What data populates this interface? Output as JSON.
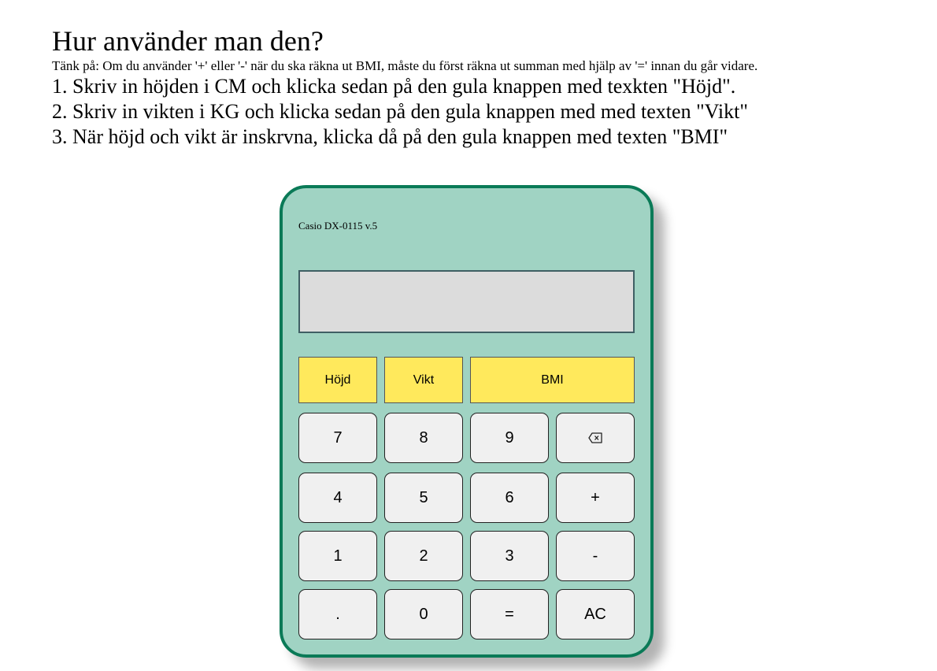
{
  "instructions": {
    "heading": "Hur använder man den?",
    "note": "Tänk på: Om du använder '+' eller '-' när du ska räkna ut BMI, måste du först räkna ut summan med hjälp av '=' innan du går vidare.",
    "steps": [
      "1. Skriv in höjden i CM och klicka sedan på den gula knappen med texkten \"Höjd\".",
      "2. Skriv in vikten i KG och klicka sedan på den gula knappen med med texten \"Vikt\"",
      "3. När höjd och vikt är inskrvna, klicka då på den gula knappen med texten \"BMI\""
    ]
  },
  "calculator": {
    "model": "Casio DX-0115 v.5",
    "display_value": "",
    "function_buttons": {
      "height": "Höjd",
      "weight": "Vikt",
      "bmi": "BMI"
    },
    "keys": {
      "k7": "7",
      "k8": "8",
      "k9": "9",
      "k4": "4",
      "k5": "5",
      "k6": "6",
      "plus": "+",
      "k1": "1",
      "k2": "2",
      "k3": "3",
      "minus": "-",
      "dot": ".",
      "k0": "0",
      "equals": "=",
      "clear": "AC"
    },
    "backspace_icon": "backspace-icon",
    "colors": {
      "body": "#a0d3c3",
      "border": "#0a7a57",
      "display": "#dcdcdc",
      "function_button": "#ffe95c",
      "key": "#f0f0f0"
    }
  }
}
